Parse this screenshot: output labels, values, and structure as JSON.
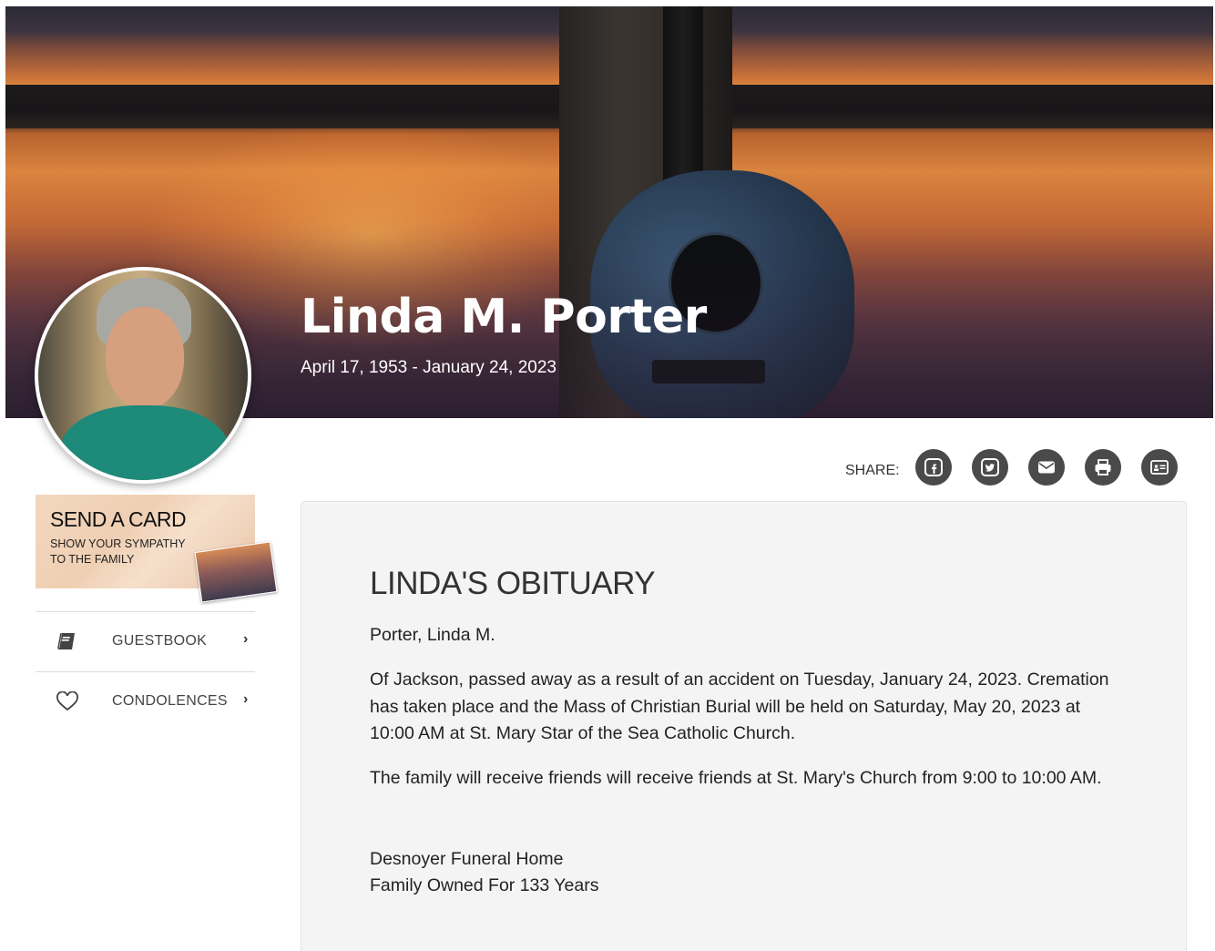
{
  "hero": {
    "name": "Linda M. Porter",
    "dates": "April 17, 1953 - January 24, 2023"
  },
  "share": {
    "label": "SHARE:",
    "buttons": [
      "facebook-icon",
      "twitter-icon",
      "email-icon",
      "print-icon",
      "vcard-icon"
    ]
  },
  "send_card": {
    "title": "SEND A CARD",
    "subtitle": "SHOW YOUR SYMPATHY TO THE FAMILY"
  },
  "sidebar": {
    "items": [
      {
        "label": "GUESTBOOK",
        "icon": "book-icon"
      },
      {
        "label": "CONDOLENCES",
        "icon": "heart-icon"
      }
    ],
    "chevron": "›"
  },
  "obituary": {
    "heading": "LINDA'S OBITUARY",
    "name_line": "Porter, Linda M.",
    "paragraph1": "Of Jackson, passed away as a result of an accident on Tuesday, January 24, 2023. Cremation has taken place and the Mass of Christian Burial will be held on Saturday, May 20, 2023 at 10:00 AM at St. Mary Star of the Sea Catholic Church.",
    "paragraph2": "The family will receive friends will receive friends at St. Mary's Church from 9:00 to 10:00 AM.",
    "funeral_home": "Desnoyer Funeral Home",
    "tagline": "Family Owned For 133 Years"
  },
  "colors": {
    "share_button": "#4a4a4a",
    "panel_background": "#f4f4f4"
  }
}
